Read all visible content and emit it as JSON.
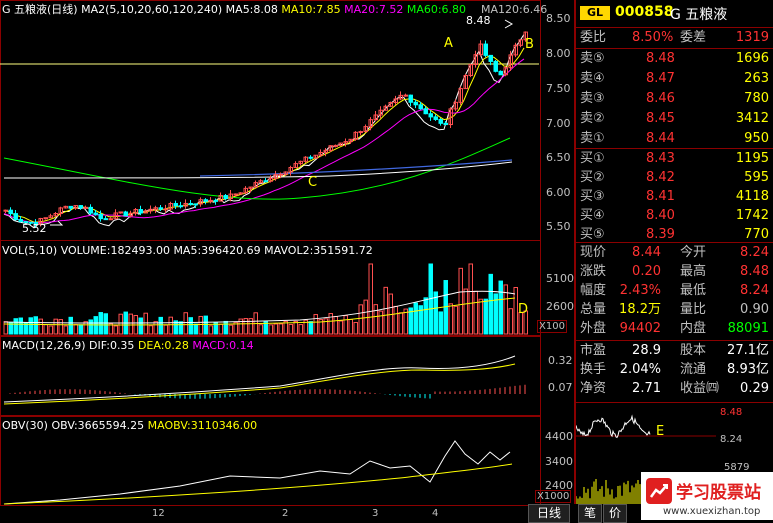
{
  "main": {
    "title": "G 五粮液(日线)",
    "ma_label": "MA2(5,10,20,60,120,240)",
    "ma5": "MA5:8.08",
    "ma10": "MA10:7.85",
    "ma20": "MA20:7.52",
    "ma60": "MA60:6.80",
    "ma120": "MA120:6.46",
    "high_note": "8.48",
    "low_note": "5.52",
    "y_ticks": [
      "8.50",
      "8.00",
      "7.50",
      "7.00",
      "6.50",
      "6.00",
      "5.50"
    ],
    "mark_A": "A",
    "mark_B": "B",
    "mark_C": "C"
  },
  "vol": {
    "title": "VOL(5,10) VOLUME:182493.00 MA5:396420.69 MAVOL2:351591.72",
    "y_ticks": [
      "5100",
      "2600"
    ],
    "unit": "X100",
    "mark_D": "D"
  },
  "macd": {
    "label": "MACD(12,26,9)",
    "dif": "DIF:0.35",
    "dea": "DEA:0.28",
    "macd": "MACD:0.14",
    "y_ticks": [
      "0.32",
      "0.07"
    ]
  },
  "obv": {
    "label": "OBV(30)",
    "obv": "OBV:3665594.25",
    "maobv": "MAOBV:3110346.00",
    "y_ticks": [
      "4400",
      "3400",
      "2400"
    ],
    "unit": "X1000"
  },
  "xaxis": {
    "labels": [
      "12",
      "2",
      "3",
      "4"
    ]
  },
  "quote": {
    "logo": "GL",
    "code": "000858",
    "name": "G 五粮液",
    "wb_label": "委比",
    "wb_val": "8.50%",
    "wc_label": "委差",
    "wc_val": "1319",
    "asks": [
      {
        "label": "卖⑤",
        "price": "8.48",
        "vol": "1696"
      },
      {
        "label": "卖④",
        "price": "8.47",
        "vol": "263"
      },
      {
        "label": "卖③",
        "price": "8.46",
        "vol": "780"
      },
      {
        "label": "卖②",
        "price": "8.45",
        "vol": "3412"
      },
      {
        "label": "卖①",
        "price": "8.44",
        "vol": "950"
      }
    ],
    "bids": [
      {
        "label": "买①",
        "price": "8.43",
        "vol": "1195"
      },
      {
        "label": "买②",
        "price": "8.42",
        "vol": "595"
      },
      {
        "label": "买③",
        "price": "8.41",
        "vol": "4118"
      },
      {
        "label": "买④",
        "price": "8.40",
        "vol": "1742"
      },
      {
        "label": "买⑤",
        "price": "8.39",
        "vol": "770"
      }
    ],
    "stats1": [
      {
        "l1": "现价",
        "v1": "8.44",
        "l2": "今开",
        "v2": "8.24"
      },
      {
        "l1": "涨跌",
        "v1": "0.20",
        "l2": "最高",
        "v2": "8.48"
      },
      {
        "l1": "幅度",
        "v1": "2.43%",
        "l2": "最低",
        "v2": "8.24"
      },
      {
        "l1": "总量",
        "v1": "18.2万",
        "l2": "量比",
        "v2": "0.90"
      },
      {
        "l1": "外盘",
        "v1": "94402",
        "l2": "内盘",
        "v2": "88091"
      }
    ],
    "stats2": [
      {
        "l1": "市盈",
        "v1": "28.9",
        "l2": "股本",
        "v2": "27.1亿"
      },
      {
        "l1": "换手",
        "v1": "2.04%",
        "l2": "流通",
        "v2": "8.93亿"
      },
      {
        "l1": "净资",
        "v1": "2.71",
        "l2": "收益㈣",
        "v2": "0.29"
      }
    ]
  },
  "mini": {
    "top": "8.48",
    "mid": "8.24",
    "bottom": "5879",
    "mark_E": "E"
  },
  "watermark": {
    "text": "学习股票站",
    "url": "www.xuexizhan.top"
  },
  "buttons": {
    "daily": "日线",
    "pen": "笔",
    "price": "价"
  }
}
